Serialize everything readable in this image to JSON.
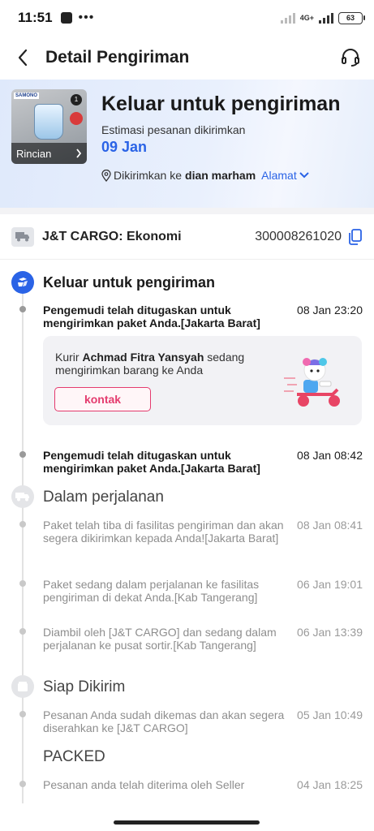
{
  "status_bar": {
    "time": "11:51",
    "dots": "•••",
    "network": "4G+",
    "battery": "63"
  },
  "header": {
    "title": "Detail Pengiriman"
  },
  "hero": {
    "product_thumb_label": "Rincian",
    "product_brand": "SAMONO",
    "status": "Keluar untuk pengiriman",
    "estimate_label": "Estimasi pesanan dikirimkan",
    "estimate_date": "09 Jan",
    "address_prefix": "Dikirimkan ke",
    "recipient": "dian marham",
    "address_link": "Alamat"
  },
  "carrier": {
    "name": "J&T CARGO: Ekonomi",
    "tracking_number": "300008261020"
  },
  "timeline": {
    "groups": [
      {
        "title": "Keluar untuk pengiriman",
        "events": [
          {
            "text": "Pengemudi telah ditugaskan untuk mengirimkan paket Anda.[Jakarta Barat]",
            "time": "08 Jan 23:20"
          },
          {
            "text": "Pengemudi telah ditugaskan untuk mengirimkan paket Anda.[Jakarta Barat]",
            "time": "08 Jan 08:42"
          }
        ],
        "courier": {
          "prefix": "Kurir",
          "name": "Achmad Fitra Yansyah",
          "suffix": "sedang mengirimkan barang ke Anda",
          "button": "kontak"
        }
      },
      {
        "title": "Dalam perjalanan",
        "events": [
          {
            "text": "Paket telah tiba di fasilitas pengiriman dan akan segera dikirimkan kepada Anda![Jakarta Barat]",
            "time": "08 Jan 08:41"
          },
          {
            "text": "Paket sedang dalam perjalanan ke fasilitas pengiriman di dekat Anda.[Kab Tangerang]",
            "time": "06 Jan 19:01"
          },
          {
            "text": "Diambil oleh [J&T CARGO] dan sedang dalam perjalanan ke pusat sortir.[Kab Tangerang]",
            "time": "06 Jan 13:39"
          }
        ]
      },
      {
        "title": "Siap Dikirim",
        "events": [
          {
            "text": "Pesanan Anda sudah dikemas dan akan segera diserahkan ke [J&T CARGO]",
            "time": "05 Jan 10:49"
          }
        ]
      },
      {
        "title": "PACKED",
        "events": [
          {
            "text": "Pesanan anda telah diterima oleh Seller",
            "time": "04 Jan 18:25"
          }
        ]
      }
    ]
  },
  "colors": {
    "accent_blue": "#2a63e6",
    "contact_pink": "#e43b6e",
    "hero_bg": "#e4ecfb"
  },
  "icons": [
    "back-arrow-icon",
    "headset-icon",
    "location-pin-icon",
    "chevron-down-icon",
    "truck-icon",
    "copy-icon",
    "delivery-icon",
    "transit-icon",
    "box-icon"
  ]
}
